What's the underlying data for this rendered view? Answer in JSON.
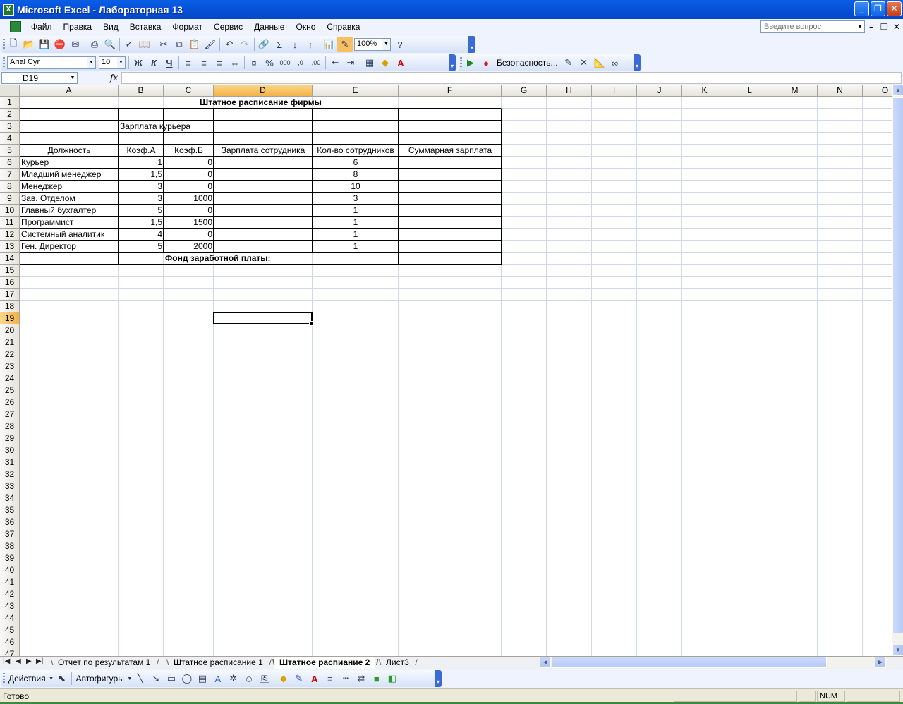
{
  "window": {
    "title": "Microsoft Excel - Лабораторная 13",
    "app_icon": "excel-icon",
    "controls": [
      "minimize-icon",
      "restore-icon",
      "close-icon"
    ]
  },
  "menu": {
    "items": [
      "Файл",
      "Правка",
      "Вид",
      "Вставка",
      "Формат",
      "Сервис",
      "Данные",
      "Окно",
      "Справка"
    ],
    "help_placeholder": "Введите вопрос"
  },
  "standard_toolbar": {
    "zoom": "100%",
    "icons": [
      "new-icon",
      "open-icon",
      "save-icon",
      "permission-icon",
      "email-icon",
      "print-icon",
      "print-preview-icon",
      "spelling-icon",
      "research-icon",
      "cut-icon",
      "copy-icon",
      "paste-icon",
      "format-painter-icon",
      "undo-icon",
      "redo-icon",
      "hyperlink-icon",
      "autosum-icon",
      "sort-asc-icon",
      "sort-desc-icon",
      "chart-wizard-icon",
      "drawing-icon",
      "help-icon"
    ]
  },
  "formatting_toolbar": {
    "font": "Arial Cyr",
    "size": "10",
    "bold": "Ж",
    "italic": "К",
    "underline": "Ч",
    "security_label": "Безопасность...",
    "icons": [
      "align-left-icon",
      "align-center-icon",
      "align-right-icon",
      "merge-center-icon",
      "currency-icon",
      "percent-icon",
      "thousands-icon",
      "increase-decimal-icon",
      "decrease-decimal-icon",
      "decrease-indent-icon",
      "increase-indent-icon",
      "borders-icon",
      "fill-color-icon",
      "font-color-icon",
      "run-macro-icon",
      "record-macro-icon",
      "visual-basic-icon",
      "control-toolbox-icon",
      "design-mode-icon",
      "script-editor-icon"
    ]
  },
  "formula_bar": {
    "name_box": "D19",
    "fx": "fx",
    "formula": ""
  },
  "grid": {
    "columns": [
      "A",
      "B",
      "C",
      "D",
      "E",
      "F",
      "G",
      "H",
      "I",
      "J",
      "K",
      "L",
      "M",
      "N",
      "O"
    ],
    "selected_column": "D",
    "rows_visible": 47,
    "selected_row": 19,
    "selected_cell": "D19"
  },
  "sheet": {
    "title": "Штатное расписание фирмы",
    "courier_salary_label": "Зарплата курьера",
    "headers": [
      "Должность",
      "Коэф.А",
      "Коэф.Б",
      "Зарплата сотрудника",
      "Кол-во сотрудников",
      "Суммарная зарплата"
    ],
    "rows": [
      {
        "position": "Курьер",
        "a": "1",
        "b": "0",
        "count": "6"
      },
      {
        "position": "Младший  менеджер",
        "a": "1,5",
        "b": "0",
        "count": "8"
      },
      {
        "position": "Менеджер",
        "a": "3",
        "b": "0",
        "count": "10"
      },
      {
        "position": "Зав. Отделом",
        "a": "3",
        "b": "1000",
        "count": "3"
      },
      {
        "position": "Главный бухгалтер",
        "a": "5",
        "b": "0",
        "count": "1"
      },
      {
        "position": "Программист",
        "a": "1,5",
        "b": "1500",
        "count": "1"
      },
      {
        "position": "Системный аналитик",
        "a": "4",
        "b": "0",
        "count": "1"
      },
      {
        "position": "Ген. Директор",
        "a": "5",
        "b": "2000",
        "count": "1"
      }
    ],
    "payroll_fund_label": "Фонд заработной платы:"
  },
  "tabs": {
    "items": [
      "Отчет по результатам 1",
      "Штатное расписание 1",
      "Штатное распиание 2",
      "Лист3"
    ],
    "active_index": 2
  },
  "drawing_toolbar": {
    "actions_label": "Действия",
    "autoshapes_label": "Автофигуры"
  },
  "status": {
    "text": "Готово",
    "num": "NUM"
  }
}
